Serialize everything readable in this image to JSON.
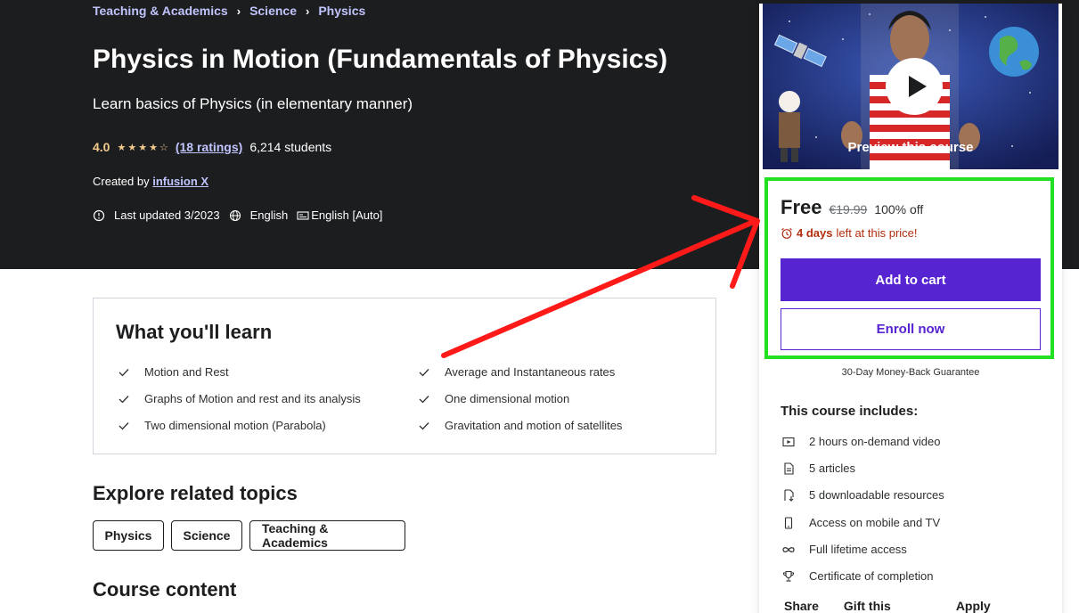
{
  "breadcrumb": [
    "Teaching & Academics",
    "Science",
    "Physics"
  ],
  "course": {
    "title": "Physics in Motion (Fundamentals of Physics)",
    "subtitle": "Learn basics of Physics (in elementary manner)",
    "rating": "4.0",
    "rating_value": 4.0,
    "ratings_link": "(18 ratings)",
    "students": "6,214 students",
    "created_by_label": "Created by",
    "author": "infusion X",
    "last_updated": "Last updated 3/2023",
    "language": "English",
    "captions": "English [Auto]"
  },
  "learn": {
    "title": "What you'll learn",
    "items": [
      "Motion and Rest",
      "Average and Instantaneous rates",
      "Graphs of Motion and rest and its analysis",
      "One dimensional motion",
      "Two dimensional motion (Parabola)",
      "Gravitation and motion of satellites"
    ]
  },
  "related": {
    "title": "Explore related topics",
    "topics": [
      "Physics",
      "Science",
      "Teaching & Academics"
    ]
  },
  "content": {
    "title": "Course content"
  },
  "sidebar": {
    "preview_label": "Preview this course",
    "price_now": "Free",
    "price_old": "€19.99",
    "discount": "100% off",
    "timer_bold": "4 days",
    "timer_rest": "left at this price!",
    "add_to_cart": "Add to cart",
    "enroll_now": "Enroll now",
    "guarantee": "30-Day Money-Back Guarantee",
    "includes_title": "This course includes:",
    "includes": [
      {
        "icon": "video-icon",
        "label": "2 hours on-demand video"
      },
      {
        "icon": "article-icon",
        "label": "5 articles"
      },
      {
        "icon": "download-icon",
        "label": "5 downloadable resources"
      },
      {
        "icon": "mobile-icon",
        "label": "Access on mobile and TV"
      },
      {
        "icon": "infinity-icon",
        "label": "Full lifetime access"
      },
      {
        "icon": "trophy-icon",
        "label": "Certificate of completion"
      }
    ],
    "footer": [
      "Share",
      "Gift this course",
      "Apply Coupon"
    ]
  },
  "colors": {
    "hero_bg": "#1c1d1f",
    "accent": "#5624d0",
    "link": "#c0c4fc",
    "star": "#f3ca8c",
    "timer": "#b32d0f",
    "highlight_box": "#22e022",
    "annotation_arrow": "#ff1a1a"
  }
}
